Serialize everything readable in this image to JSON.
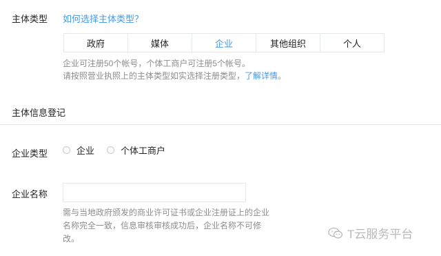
{
  "entity_type": {
    "label": "主体类型",
    "help_link": "如何选择主体类型？",
    "tabs": [
      {
        "label": "政府",
        "active": false
      },
      {
        "label": "媒体",
        "active": false
      },
      {
        "label": "企业",
        "active": true
      },
      {
        "label": "其他组织",
        "active": false
      },
      {
        "label": "个人",
        "active": false
      }
    ],
    "tip_line1": "企业可注册50个帐号，个体工商户可注册5个帐号。",
    "tip_line2_text": "请按照营业执照上的主体类型如实选择注册类型，",
    "tip_line2_link": "了解详情",
    "tip_line2_end": "。"
  },
  "registration": {
    "section_title": "主体信息登记"
  },
  "company_type": {
    "label": "企业类型",
    "options": [
      "企业",
      "个体工商户"
    ]
  },
  "company_name": {
    "label": "企业名称",
    "value": "",
    "hint_line1": "需与当地政府颁发的商业许可证书或企业注册证上的企业",
    "hint_line2": "名称完全一致，信息审核审核成功后，企业名称不可修",
    "hint_line3": "改。"
  },
  "watermark": {
    "text": "T云服务平台",
    "icon": "wechat-icon"
  },
  "colors": {
    "accent": "#459ae9",
    "muted": "#8d8d8d",
    "border": "#e4e8eb"
  }
}
